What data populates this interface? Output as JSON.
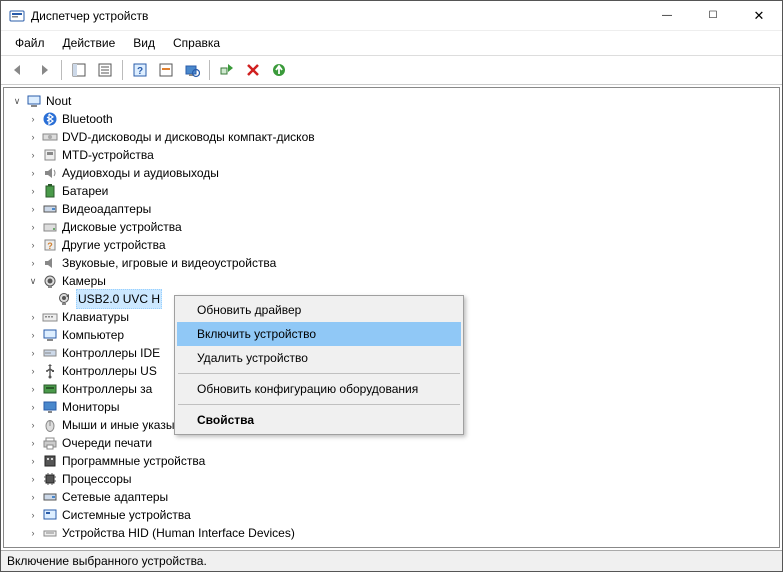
{
  "window": {
    "title": "Диспетчер устройств",
    "minimize": "—",
    "maximize": "☐",
    "close": "✕"
  },
  "menu": {
    "file": "Файл",
    "action": "Действие",
    "view": "Вид",
    "help": "Справка"
  },
  "tree": {
    "root": "Nout",
    "bluetooth": "Bluetooth",
    "dvd": "DVD-дисководы и дисководы компакт-дисков",
    "mtd": "MTD-устройства",
    "audio": "Аудиовходы и аудиовыходы",
    "battery": "Батареи",
    "video": "Видеоадаптеры",
    "disk": "Дисковые устройства",
    "other": "Другие устройства",
    "sound": "Звуковые, игровые и видеоустройства",
    "camera": "Камеры",
    "usb_cam": "USB2.0 UVC H",
    "keyboard": "Клавиатуры",
    "computer": "Компьютер",
    "ide": "Контроллеры IDE",
    "usb": "Контроллеры US",
    "storage": "Контроллеры за",
    "monitor": "Мониторы",
    "mouse": "Мыши и иные указывающие устройства",
    "print": "Очереди печати",
    "software": "Программные устройства",
    "cpu": "Процессоры",
    "network": "Сетевые адаптеры",
    "system": "Системные устройства",
    "hid": "Устройства HID (Human Interface Devices)"
  },
  "context_menu": {
    "update_driver": "Обновить драйвер",
    "enable": "Включить устройство",
    "remove": "Удалить устройство",
    "scan": "Обновить конфигурацию оборудования",
    "properties": "Свойства"
  },
  "status": "Включение выбранного устройства."
}
